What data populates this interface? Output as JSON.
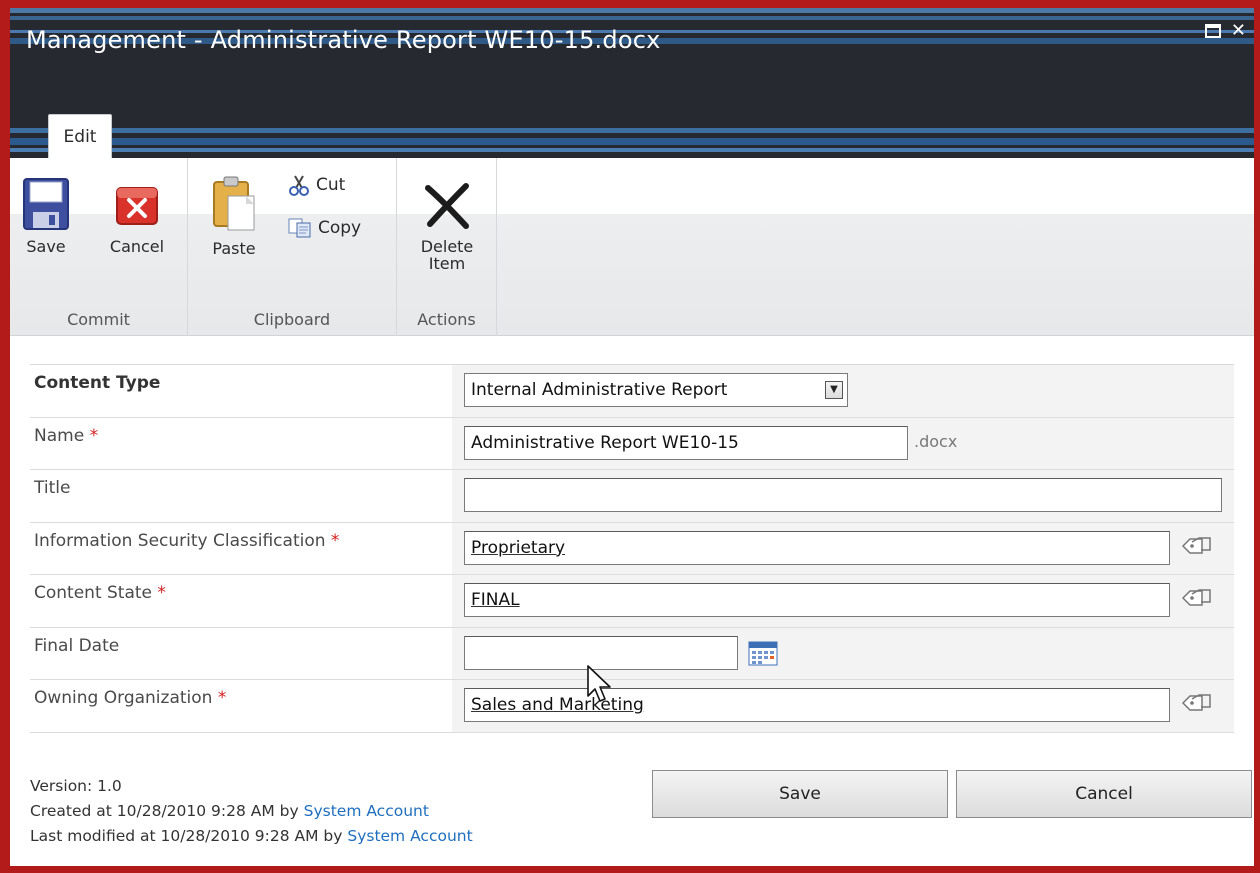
{
  "dialog": {
    "title": "Management - Administrative Report WE10-15.docx"
  },
  "ribbon": {
    "tab_label": "Edit",
    "commit": {
      "group_label": "Commit",
      "save_label": "Save",
      "cancel_label": "Cancel"
    },
    "clipboard": {
      "group_label": "Clipboard",
      "paste_label": "Paste",
      "cut_label": "Cut",
      "copy_label": "Copy"
    },
    "actions": {
      "group_label": "Actions",
      "delete_line1": "Delete",
      "delete_line2": "Item"
    }
  },
  "form": {
    "content_type": {
      "label": "Content Type",
      "value": "Internal Administrative Report"
    },
    "name": {
      "label": "Name",
      "required_mark": "*",
      "value": "Administrative Report WE10-15",
      "suffix": ".docx"
    },
    "title": {
      "label": "Title",
      "value": ""
    },
    "security": {
      "label": "Information Security Classification",
      "required_mark": "*",
      "value": "Proprietary"
    },
    "content_state": {
      "label": "Content State",
      "required_mark": "*",
      "value": "FINAL"
    },
    "final_date": {
      "label": "Final Date",
      "value": ""
    },
    "owning_org": {
      "label": "Owning Organization",
      "required_mark": "*",
      "value": "Sales and Marketing"
    }
  },
  "footer": {
    "version": "Version: 1.0",
    "created_prefix": "Created at 10/28/2010 9:28 AM by",
    "created_by": "System Account",
    "modified_prefix": "Last modified at 10/28/2010 9:28 AM by",
    "modified_by": "System Account",
    "save_label": "Save",
    "cancel_label": "Cancel"
  },
  "colors": {
    "frame": "#b31b1b",
    "header": "#262a30",
    "required": "#d21f1f",
    "link": "#1f6fbf"
  }
}
